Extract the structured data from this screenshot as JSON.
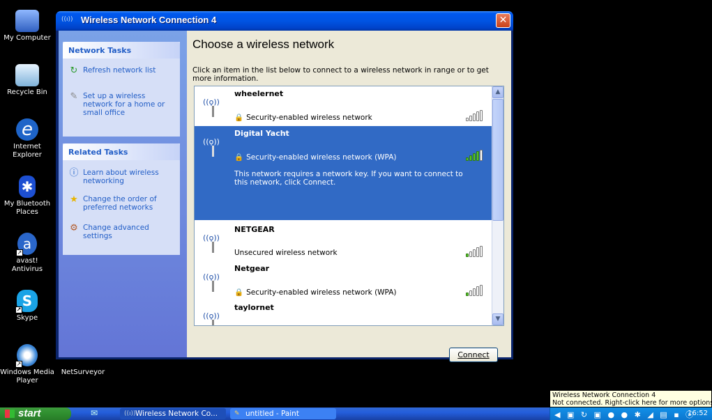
{
  "desktop": {
    "icons": [
      {
        "label": "My Computer"
      },
      {
        "label": "Recycle Bin"
      },
      {
        "label": "Internet Explorer"
      },
      {
        "label": "My Bluetooth Places"
      },
      {
        "label": "avast! Antivirus"
      },
      {
        "label": "Skype"
      },
      {
        "label": "Windows Media Player"
      },
      {
        "label": "NetSurveyor"
      }
    ]
  },
  "window": {
    "title": "Wireless Network Connection 4",
    "close_label": "✕"
  },
  "sidebar": {
    "network_tasks": {
      "header": "Network Tasks",
      "items": [
        {
          "label": "Refresh network list",
          "icon": "refresh-icon"
        },
        {
          "label": "Set up a wireless network for a home or small office",
          "icon": "setup-wizard-icon"
        }
      ]
    },
    "related_tasks": {
      "header": "Related Tasks",
      "items": [
        {
          "label": "Learn about wireless networking",
          "icon": "info-icon"
        },
        {
          "label": "Change the order of preferred networks",
          "icon": "star-icon"
        },
        {
          "label": "Change advanced settings",
          "icon": "settings-icon"
        }
      ]
    }
  },
  "main": {
    "heading": "Choose a wireless network",
    "intro": "Click an item in the list below to connect to a wireless network in range or to get more information.",
    "networks": [
      {
        "name": "wheelernet",
        "security": "Security-enabled wireless network",
        "secured": true,
        "signal_bars": 0,
        "selected": false
      },
      {
        "name": "Digital Yacht",
        "security": "Security-enabled wireless network (WPA)",
        "secured": true,
        "signal_bars": 4,
        "selected": true,
        "description": "This network requires a network key. If you want to connect to this network, click Connect."
      },
      {
        "name": "NETGEAR",
        "security": "Unsecured wireless network",
        "secured": false,
        "signal_bars": 1,
        "selected": false
      },
      {
        "name": "Netgear",
        "security": "Security-enabled wireless network (WPA)",
        "secured": true,
        "signal_bars": 1,
        "selected": false
      },
      {
        "name": "taylornet",
        "security": "",
        "secured": true,
        "signal_bars": 0,
        "selected": false
      }
    ],
    "connect_label": "Connect"
  },
  "taskbar": {
    "start_label": "start",
    "buttons": [
      {
        "label": "Wireless Network Co..."
      },
      {
        "label": "untitled - Paint"
      }
    ],
    "clock": "16:52"
  },
  "tooltip": {
    "line1": "Wireless Network Connection 4",
    "line2": "Not connected. Right-click here for more options"
  },
  "colors": {
    "title_blue": "#0054e3",
    "selection_blue": "#316ac5",
    "sidebar_blue": "#7ba2e7",
    "signal_green": "#57c22b"
  }
}
